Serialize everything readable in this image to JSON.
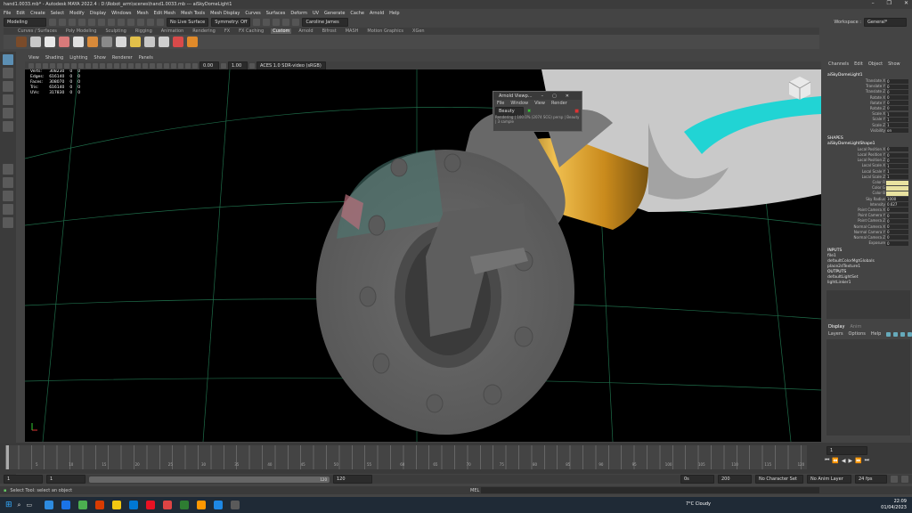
{
  "window": {
    "title": "hand1.0033.mb* - Autodesk MAYA 2022.4 : D:\\Robot_arm\\scenes\\hand1.0033.mb --- aiSkyDomeLight1",
    "controls": [
      "–",
      "❐",
      "✕"
    ]
  },
  "menubar": [
    "File",
    "Edit",
    "Create",
    "Select",
    "Modify",
    "Display",
    "Windows",
    "Mesh",
    "Edit Mesh",
    "Mesh Tools",
    "Mesh Display",
    "Curves",
    "Surfaces",
    "Deform",
    "UV",
    "Generate",
    "Cache",
    "Arnold",
    "Help"
  ],
  "statusline": {
    "mode": "Modeling",
    "live_surface": "No Live Surface",
    "symmetry": "Symmetry: Off",
    "user": "Caroline James",
    "workspace_label": "Workspace :",
    "workspace": "General*"
  },
  "shelf_tabs": [
    {
      "label": "Curves / Surfaces",
      "active": false
    },
    {
      "label": "Poly Modeling",
      "active": false
    },
    {
      "label": "Sculpting",
      "active": false
    },
    {
      "label": "Rigging",
      "active": false
    },
    {
      "label": "Animation",
      "active": false
    },
    {
      "label": "Rendering",
      "active": false
    },
    {
      "label": "FX",
      "active": false
    },
    {
      "label": "FX Caching",
      "active": false
    },
    {
      "label": "Custom",
      "active": true
    },
    {
      "label": "Arnold",
      "active": false
    },
    {
      "label": "Bifrost",
      "active": false
    },
    {
      "label": "MASH",
      "active": false
    },
    {
      "label": "Motion Graphics",
      "active": false
    },
    {
      "label": "XGen",
      "active": false
    }
  ],
  "shelf_icon_colors": [
    "#7a4b2a",
    "#c8c8c8",
    "#e8e8e8",
    "#d87a7a",
    "#e0e0e0",
    "#d88a3a",
    "#8a8a8a",
    "#d8d8d8",
    "#e2c04a",
    "#c8c8c8",
    "#cfcfcf",
    "#d84a4a",
    "#e08a2a"
  ],
  "viewport_menu": [
    "View",
    "Shading",
    "Lighting",
    "Show",
    "Renderer",
    "Panels"
  ],
  "viewport_toolbar": {
    "field1": "0.00",
    "field2": "1.00",
    "colorspace": "ACES 1.0 SDR-video (sRGB)"
  },
  "hud": [
    {
      "label": "Verts:",
      "v1": "308230",
      "v2": "0",
      "v3": "0"
    },
    {
      "label": "Edges:",
      "v1": "616140",
      "v2": "0",
      "v3": "0"
    },
    {
      "label": "Faces:",
      "v1": "308070",
      "v2": "0",
      "v3": "0"
    },
    {
      "label": "Tris:",
      "v1": "616140",
      "v2": "0",
      "v3": "0"
    },
    {
      "label": "UVs:",
      "v1": "317830",
      "v2": "0",
      "v3": "0"
    }
  ],
  "arnold_viewer": {
    "title": "Arnold Viewp...",
    "menu": [
      "File",
      "Window",
      "View",
      "Render"
    ],
    "display": "Beauty",
    "status": "Rendering | 100.0% (2074 SCG) persp | Beauty | 3 sample"
  },
  "channel_box": {
    "tabs": [
      "Channels",
      "Edit",
      "Object",
      "Show"
    ],
    "node": "aiSkyDomeLight1",
    "transform_attrs": [
      {
        "name": "Translate X",
        "value": "0"
      },
      {
        "name": "Translate Y",
        "value": "0"
      },
      {
        "name": "Translate Z",
        "value": "0"
      },
      {
        "name": "Rotate X",
        "value": "0"
      },
      {
        "name": "Rotate Y",
        "value": "0"
      },
      {
        "name": "Rotate Z",
        "value": "0"
      },
      {
        "name": "Scale X",
        "value": "1"
      },
      {
        "name": "Scale Y",
        "value": "1"
      },
      {
        "name": "Scale Z",
        "value": "1"
      },
      {
        "name": "Visibility",
        "value": "on"
      }
    ],
    "shapes_label": "SHAPES",
    "shape_node": "aiSkyDomeLightShape1",
    "shape_attrs": [
      {
        "name": "Local Position X",
        "value": "0"
      },
      {
        "name": "Local Position Y",
        "value": "0"
      },
      {
        "name": "Local Position Z",
        "value": "0"
      },
      {
        "name": "Local Scale X",
        "value": "1"
      },
      {
        "name": "Local Scale Y",
        "value": "1"
      },
      {
        "name": "Local Scale Z",
        "value": "1"
      },
      {
        "name": "Color R",
        "value": ""
      },
      {
        "name": "Color G",
        "value": ""
      },
      {
        "name": "Color B",
        "value": ""
      },
      {
        "name": "Sky Radius",
        "value": "1000"
      },
      {
        "name": "Intensity",
        "value": "0.627"
      },
      {
        "name": "Point Camera X",
        "value": "0"
      },
      {
        "name": "Point Camera Y",
        "value": "0"
      },
      {
        "name": "Point Camera Z",
        "value": "0"
      },
      {
        "name": "Normal Camera X",
        "value": "0"
      },
      {
        "name": "Normal Camera Y",
        "value": "0"
      },
      {
        "name": "Normal Camera Z",
        "value": "0"
      },
      {
        "name": "Exposure",
        "value": "0"
      }
    ],
    "inputs_label": "INPUTS",
    "inputs": [
      "file1",
      "defaultColorMgtGlobals",
      "place2dTexture1"
    ],
    "outputs_label": "OUTPUTS",
    "outputs": [
      "defaultLightSet",
      "lightLinker1"
    ]
  },
  "layer_editor": {
    "tabs": [
      "Display",
      "Anim"
    ],
    "menu": [
      "Layers",
      "Options",
      "Help"
    ]
  },
  "timeline": {
    "labels": [
      "5",
      "10",
      "15",
      "20",
      "25",
      "30",
      "35",
      "40",
      "45",
      "50",
      "55",
      "60",
      "65",
      "70",
      "75",
      "80",
      "85",
      "90",
      "95",
      "100",
      "105",
      "110",
      "115",
      "120"
    ],
    "current": "1"
  },
  "range": {
    "start": "1",
    "start2": "1",
    "end": "120",
    "end2": "120",
    "fps1": "0s",
    "fps2": "200",
    "character_set": "No Character Set",
    "anim_layer": "No Anim Layer",
    "fps": "24 fps"
  },
  "command": {
    "lang": "MEL"
  },
  "help_line": "Select Tool: select an object",
  "taskbar": {
    "icon_colors": [
      "#2d8be0",
      "#1a73e8",
      "#4caf50",
      "#d83b01",
      "#f2c811",
      "#0078d4",
      "#e81123",
      "#d44",
      "#2e7d32",
      "#ff9800",
      "#1e88e5",
      "#5a5a5a"
    ],
    "weather": "7°C  Cloudy",
    "time": "22:09",
    "date": "01/04/2023"
  }
}
